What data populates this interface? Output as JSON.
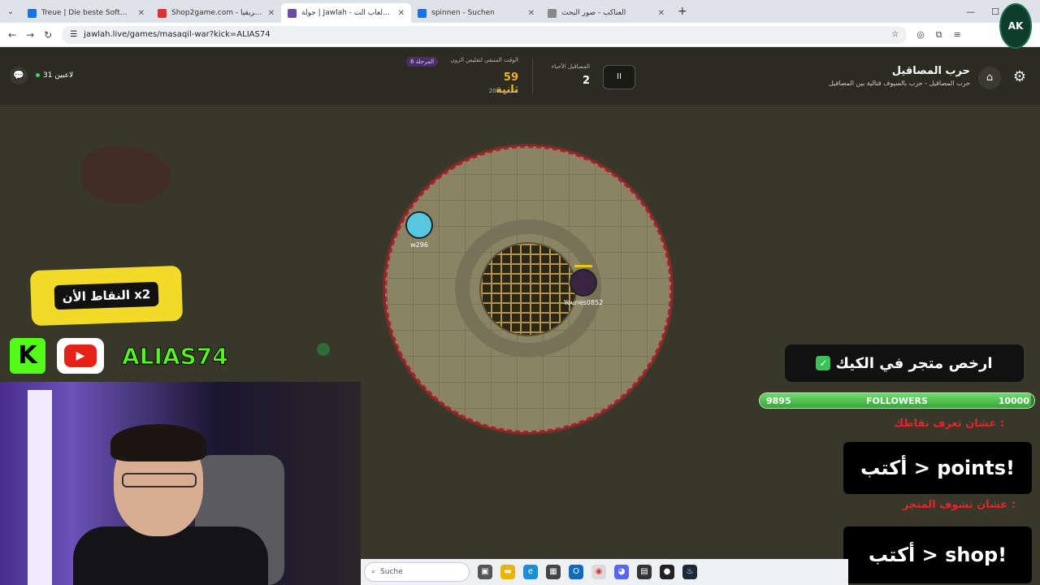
{
  "browser": {
    "tabs": [
      {
        "title": "Treue | Die beste Software zur Ku",
        "color": "#1a73e8",
        "active": false
      },
      {
        "title": "Shop2game.com - شمال أفريقيا",
        "color": "#d33",
        "active": false
      },
      {
        "title": "جولة | Jawlah - منصة الألعاب الت",
        "color": "#6b4ea3",
        "active": true
      },
      {
        "title": "spinnen - Suchen",
        "color": "#1a73e8",
        "active": false
      },
      {
        "title": "العناكب - صور البحث",
        "color": "#888",
        "active": false
      }
    ],
    "url": "jawlah.live/games/masaqil-war?kick=ALIAS74"
  },
  "game": {
    "title": "حرب المصاقيل",
    "subtitle": "حرب المصاقيل - حرب بالسيوف قتالية بين المصاقيل",
    "alive_label": "المصاقيل الأحياء",
    "alive_count": "2",
    "pause_label": "II",
    "phase_badge": "المرحلة 6",
    "timer_label": "الوقت المتبقي لتقليص الزون",
    "timer_value": "59 ثانية",
    "shrink_pct": "20% تقليص",
    "players_online": "31 لاعبين",
    "players": [
      {
        "name": "w296",
        "color": "#58c7e0"
      },
      {
        "name": "Younes0852",
        "color": "#3a2540"
      }
    ]
  },
  "overlay": {
    "points_banner": "النقاط الأن x2",
    "streamer_name": "ALIAS74",
    "promo": "ارخص متجر في الكيك",
    "followers": {
      "current": "9895",
      "label": "FOLLOWERS",
      "goal": "10000",
      "progress": 0.9895
    },
    "caption_points": "عشان تعرف نقاطك :",
    "command_points": "أكتب > points!",
    "caption_shop": "عشان تشوف المتجر :",
    "command_shop": "أكتب > shop!"
  },
  "taskbar": {
    "search_placeholder": "Suche"
  },
  "icons": {
    "kick_color": "#53fc18",
    "youtube_color": "#e62117",
    "zone_border_color": "#c21f2a"
  }
}
